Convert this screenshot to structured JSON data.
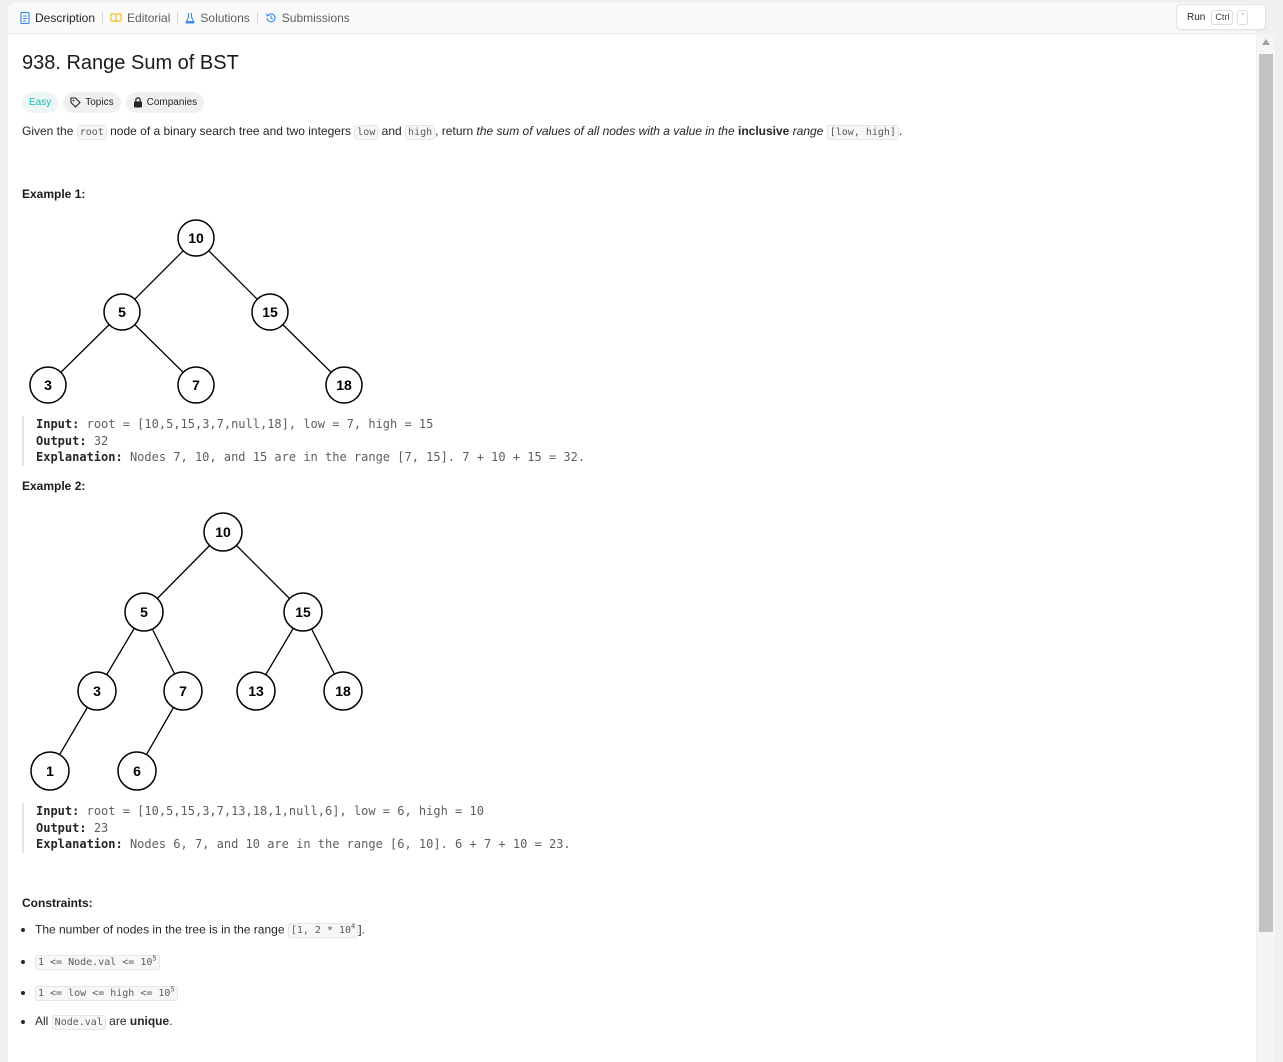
{
  "tabs": [
    {
      "label": "Description",
      "icon": "document-icon",
      "active": true
    },
    {
      "label": "Editorial",
      "icon": "book-icon",
      "active": false
    },
    {
      "label": "Solutions",
      "icon": "flask-icon",
      "active": false
    },
    {
      "label": "Submissions",
      "icon": "history-icon",
      "active": false
    }
  ],
  "runbox": {
    "run": "Run",
    "ctrl": "Ctrl",
    "key": "'"
  },
  "problem": {
    "title": "938. Range Sum of BST",
    "difficulty": "Easy",
    "difficulty_color": "#1cb8b8",
    "topics": "Topics",
    "companies": "Companies"
  },
  "desc": {
    "p1": "Given the ",
    "c1": "root",
    "p2": " node of a binary search tree and two integers ",
    "c2": "low",
    "p3": " and ",
    "c3": "high",
    "p4": ", return ",
    "i1": "the sum of values of all nodes with a value in the ",
    "b1": "inclusive",
    "i2": " range ",
    "c4": "[low, high]",
    "p5": "."
  },
  "example1": {
    "label": "Example 1:",
    "nodes": [
      "10",
      "5",
      "15",
      "3",
      "7",
      "18"
    ],
    "input_label": "Input:",
    "input": "root = [10,5,15,3,7,null,18], low = 7, high = 15",
    "output_label": "Output:",
    "output": "32",
    "explanation_label": "Explanation:",
    "explanation": "Nodes 7, 10, and 15 are in the range [7, 15]. 7 + 10 + 15 = 32."
  },
  "example2": {
    "label": "Example 2:",
    "nodes": [
      "10",
      "5",
      "15",
      "3",
      "7",
      "13",
      "18",
      "1",
      "6"
    ],
    "input_label": "Input:",
    "input": "root = [10,5,15,3,7,13,18,1,null,6], low = 6, high = 10",
    "output_label": "Output:",
    "output": "23",
    "explanation_label": "Explanation:",
    "explanation": "Nodes 6, 7, and 10 are in the range [6, 10]. 6 + 7 + 10 = 23."
  },
  "constraints": {
    "label": "Constraints:",
    "c1_text": "The number of nodes in the tree is in the range ",
    "c1_code": "[1, 2 * 10",
    "c1_sup": "4",
    "c1_end": "].",
    "c2_code": "1 <= Node.val <= 10",
    "c2_sup": "5",
    "c3_code": "1 <= low <= high <= 10",
    "c3_sup": "5",
    "c4_pre": "All ",
    "c4_code": "Node.val",
    "c4_mid": " are ",
    "c4_bold": "unique",
    "c4_end": "."
  }
}
